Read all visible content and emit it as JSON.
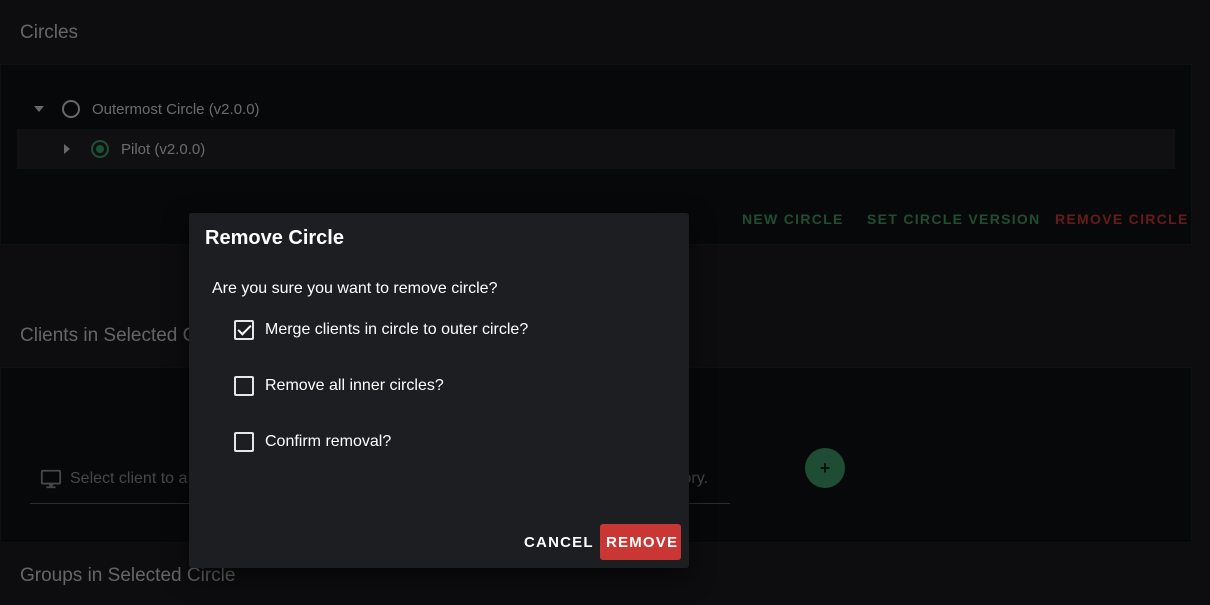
{
  "circles": {
    "title": "Circles",
    "tree": [
      {
        "label": "Outermost Circle (v2.0.0)",
        "expanded": true,
        "selected": false
      },
      {
        "label": "Pilot (v2.0.0)",
        "expanded": false,
        "selected": true
      }
    ],
    "actions": {
      "new_circle": "NEW CIRCLE",
      "set_version": "SET CIRCLE VERSION",
      "remove_circle": "REMOVE CIRCLE"
    },
    "colors": {
      "accent": "#3e9a66",
      "danger": "#c93634"
    }
  },
  "clients": {
    "title": "Clients in Selected C",
    "field_placeholder_left": "Select client to a",
    "field_placeholder_right": "ory.",
    "add_button": "+"
  },
  "groups": {
    "title": "Groups in Selected Circle"
  },
  "dialog": {
    "title": "Remove Circle",
    "question": "Are you sure you want to remove circle?",
    "options": [
      {
        "label": "Merge clients in circle to outer circle?",
        "checked": true
      },
      {
        "label": "Remove all inner circles?",
        "checked": false
      },
      {
        "label": "Confirm removal?",
        "checked": false
      }
    ],
    "cancel_label": "CANCEL",
    "remove_label": "REMOVE"
  }
}
